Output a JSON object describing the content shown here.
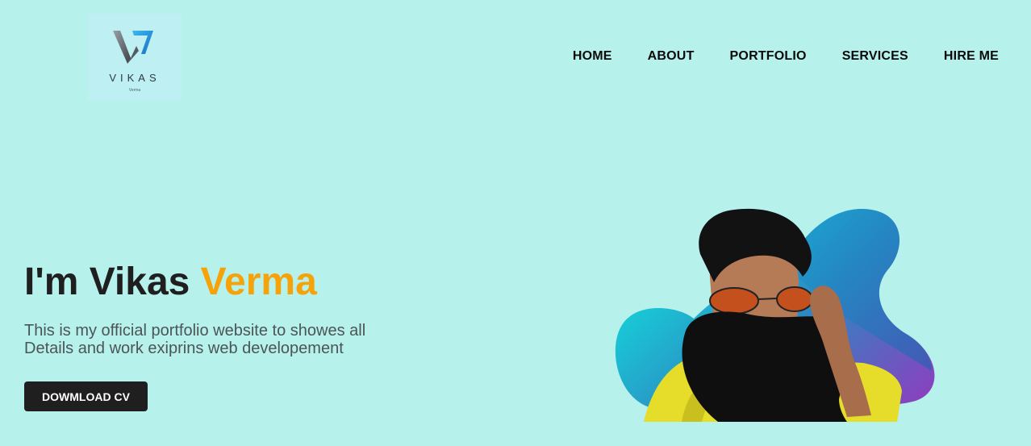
{
  "logo": {
    "name": "VIKAS",
    "tagline": "Verma"
  },
  "nav": {
    "items": [
      {
        "label": "HOME"
      },
      {
        "label": "ABOUT"
      },
      {
        "label": "PORTFOLIO"
      },
      {
        "label": "SERVICES"
      },
      {
        "label": "HIRE ME"
      }
    ]
  },
  "hero": {
    "title_prefix": "I'm Vikas ",
    "title_accent": "Verma",
    "description": "This is my official portfolio website to showes all Details and work exiprins web developement",
    "button_label": "DOWMLOAD CV",
    "image_subject": "man-wearing-sunglasses-and-black-face-scarf"
  },
  "colors": {
    "background": "#b6f1ec",
    "accent": "#f6a30a",
    "button": "#1f1f1f",
    "blob_start": "#0ee6de",
    "blob_end": "#8c3fbf"
  }
}
